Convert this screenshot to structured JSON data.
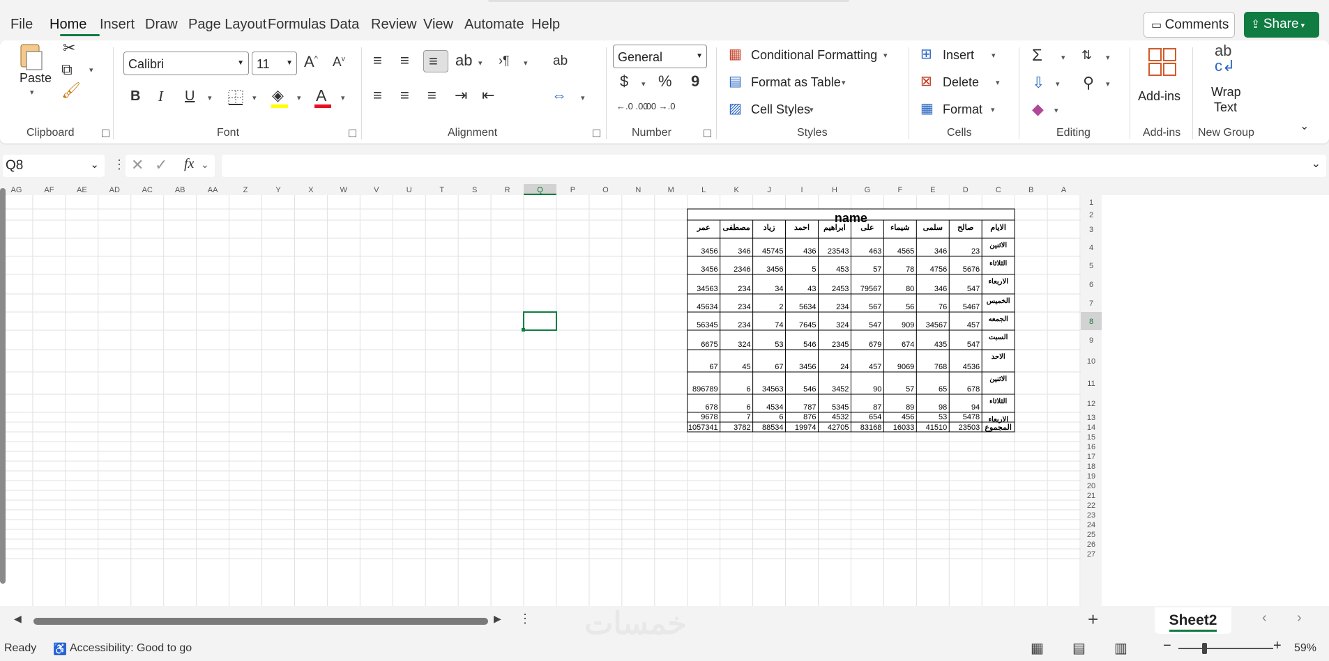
{
  "menu": {
    "items": [
      "File",
      "Home",
      "Insert",
      "Draw",
      "Page Layout",
      "Formulas",
      "Data",
      "Review",
      "View",
      "Automate",
      "Help"
    ],
    "active": "Home",
    "comments_label": "Comments",
    "share_label": "Share"
  },
  "ribbon": {
    "clipboard": {
      "paste_label": "Paste",
      "group_label": "Clipboard"
    },
    "font": {
      "font_name": "Calibri",
      "font_size": "11",
      "group_label": "Font",
      "bold": "B",
      "italic": "I",
      "underline": "U",
      "highlight_color": "#ffff00",
      "font_color": "#e81123"
    },
    "alignment": {
      "group_label": "Alignment"
    },
    "number": {
      "format": "General",
      "currency": "$",
      "percent": "%",
      "comma": "9",
      "inc_decimal": "←.0 .00",
      "dec_decimal": ".00 →.0",
      "group_label": "Number"
    },
    "styles": {
      "conditional_formatting": "Conditional Formatting",
      "format_as_table": "Format as Table",
      "cell_styles": "Cell Styles",
      "group_label": "Styles"
    },
    "cells": {
      "insert": "Insert",
      "delete": "Delete",
      "format": "Format",
      "group_label": "Cells"
    },
    "editing": {
      "group_label": "Editing"
    },
    "addins": {
      "label": "Add-ins",
      "group_label": "Add-ins"
    },
    "newgroup": {
      "wrap_label_1": "Wrap",
      "wrap_label_2": "Text",
      "group_label": "New Group"
    }
  },
  "formula_bar": {
    "name_box": "Q8",
    "fx": "fx",
    "value": ""
  },
  "grid": {
    "columns": [
      "AG",
      "AF",
      "AE",
      "AD",
      "AC",
      "AB",
      "AA",
      "Z",
      "Y",
      "X",
      "W",
      "V",
      "U",
      "T",
      "S",
      "R",
      "Q",
      "P",
      "O",
      "N",
      "M",
      "L",
      "K",
      "J",
      "I",
      "H",
      "G",
      "F",
      "E",
      "D",
      "C",
      "B",
      "A"
    ],
    "active_column": "Q",
    "active_row": 8,
    "row_count": 27
  },
  "table": {
    "title": "name",
    "headers": [
      "الايام",
      "صالح",
      "سلمى",
      "شيماء",
      "على",
      "ابراهيم",
      "احمد",
      "زياد",
      "مصطفى",
      "عمر"
    ],
    "rows": [
      {
        "day": "الاثنين",
        "values": [
          "23",
          "346",
          "4565",
          "463",
          "23543",
          "436",
          "45745",
          "346",
          "3456"
        ]
      },
      {
        "day": "الثلاثاء",
        "values": [
          "5676",
          "4756",
          "78",
          "57",
          "453",
          "5",
          "3456",
          "2346",
          "3456"
        ]
      },
      {
        "day": "الاربعاء",
        "values": [
          "547",
          "346",
          "80",
          "79567",
          "2453",
          "43",
          "34",
          "234",
          "34563"
        ]
      },
      {
        "day": "الخميس",
        "values": [
          "5467",
          "76",
          "56",
          "567",
          "234",
          "5634",
          "2",
          "234",
          "45634"
        ]
      },
      {
        "day": "الجمعه",
        "values": [
          "457",
          "34567",
          "909",
          "547",
          "324",
          "7645",
          "74",
          "234",
          "56345"
        ]
      },
      {
        "day": "السبت",
        "values": [
          "547",
          "435",
          "674",
          "679",
          "2345",
          "546",
          "53",
          "324",
          "6675"
        ]
      },
      {
        "day": "الاحد",
        "values": [
          "4536",
          "768",
          "9069",
          "457",
          "24",
          "3456",
          "67",
          "45",
          "67"
        ]
      },
      {
        "day": "الاثنين",
        "values": [
          "678",
          "65",
          "57",
          "90",
          "3452",
          "546",
          "34563",
          "6",
          "896789"
        ]
      },
      {
        "day": "الثلاثاء",
        "values": [
          "94",
          "98",
          "89",
          "87",
          "5345",
          "787",
          "4534",
          "6",
          "678"
        ]
      },
      {
        "day": "الاربعاء",
        "values": [
          "5478",
          "53",
          "456",
          "654",
          "4532",
          "876",
          "6",
          "7",
          "9678"
        ]
      }
    ],
    "total": {
      "day": "المجموع",
      "values": [
        "23503",
        "41510",
        "16033",
        "83168",
        "42705",
        "19974",
        "88534",
        "3782",
        "1057341"
      ]
    }
  },
  "sheet": {
    "tab": "Sheet2",
    "watermark": "خمسات"
  },
  "status": {
    "ready": "Ready",
    "accessibility": "Accessibility: Good to go",
    "zoom": "59%"
  }
}
